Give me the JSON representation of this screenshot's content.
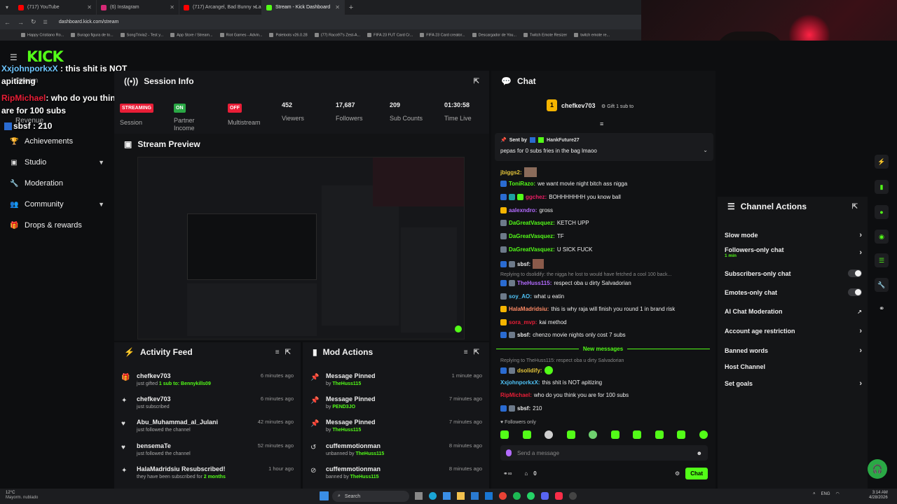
{
  "browser": {
    "tabs": [
      {
        "label": "(717) YouTube",
        "color": "#ff0000"
      },
      {
        "label": "(6) Instagram",
        "color": "#d62976"
      },
      {
        "label": "(717) Arcangel, Bad Bunny - La",
        "color": "#ff0000"
      },
      {
        "label": "Stream - Kick Dashboard",
        "color": "#53fc18"
      }
    ],
    "url": "dashboard.kick.com/stream",
    "bookmarks": [
      "Happy Cristiano Ro...",
      "Burago figura de to...",
      "SongTrivia2 - Test y...",
      "App Store / Stream...",
      "Riot Games - Advin...",
      "Paletools v26.0.28",
      "(77) Raco97's Zest-A...",
      "FIFA 23 FUT Card Cr...",
      "FIFA 23 Card creator...",
      "Descargador de You...",
      "Twitch Emote Resizer",
      "twitch emote re..."
    ]
  },
  "logo": "KICK",
  "overlay": {
    "line1_user": "XxjohnporkxX",
    "line1_text": " : this shit is NOT",
    "line2": "apitizing",
    "line3_user": "RipMichael",
    "line3_text": ": who do you think you",
    "line4": "are for 100 subs",
    "line5_user": "sbsf",
    "line5_text": ": 210"
  },
  "sidebar": {
    "stream_label": "Stream",
    "revenue_label": "Revenue",
    "items": [
      {
        "label": "Achievements",
        "icon": "trophy-icon"
      },
      {
        "label": "Studio",
        "icon": "video-icon"
      },
      {
        "label": "Moderation",
        "icon": "wrench-icon"
      },
      {
        "label": "Community",
        "icon": "people-icon"
      },
      {
        "label": "Drops & rewards",
        "icon": "gift-icon"
      }
    ]
  },
  "session": {
    "title": "Session Info",
    "stats": [
      {
        "value": "STREAMING",
        "label": "Session",
        "badge": true,
        "color": "#e91e37"
      },
      {
        "value": "ON",
        "label": "Partner Income",
        "badge": true,
        "color": "#2aa845"
      },
      {
        "value": "OFF",
        "label": "Multistream",
        "badge": true,
        "color": "#e91e37"
      },
      {
        "value": "452",
        "label": "Viewers"
      },
      {
        "value": "17,687",
        "label": "Followers"
      },
      {
        "value": "209",
        "label": "Sub Counts"
      },
      {
        "value": "01:30:58",
        "label": "Time Live"
      }
    ]
  },
  "preview": {
    "title": "Stream Preview"
  },
  "activity": {
    "title": "Activity Feed",
    "items": [
      {
        "user": "chefkev703",
        "line": "just gifted",
        "highlight": "1 sub to: Bennykills09",
        "time": "6 minutes ago",
        "icon": "gift-icon"
      },
      {
        "user": "chefkev703",
        "line": "just subscribed",
        "highlight": "",
        "time": "6 minutes ago",
        "icon": "star-icon"
      },
      {
        "user": "Abu_Muhammad_al_Julani",
        "line": "just followed the channel",
        "highlight": "",
        "time": "42 minutes ago",
        "icon": "heart-icon"
      },
      {
        "user": "bensemaTe",
        "line": "just followed the channel",
        "highlight": "",
        "time": "52 minutes ago",
        "icon": "heart-icon"
      },
      {
        "user": "HalaMadridsiu Resubscribed!",
        "line": "they have been subscribed for",
        "highlight": "2 months",
        "time": "1 hour ago",
        "icon": "star-icon"
      }
    ]
  },
  "mod": {
    "title": "Mod Actions",
    "items": [
      {
        "action": "Message Pinned",
        "by": "TheHuss115",
        "time": "1 minute ago",
        "prefix": "by",
        "icon": "pin-icon"
      },
      {
        "action": "Message Pinned",
        "by": "PEND3JO",
        "time": "7 minutes ago",
        "prefix": "by",
        "icon": "pin-icon"
      },
      {
        "action": "Message Pinned",
        "by": "TheHuss115",
        "time": "7 minutes ago",
        "prefix": "by",
        "icon": "pin-icon"
      },
      {
        "action": "cuffemmotionman",
        "by": "TheHuss115",
        "time": "8 minutes ago",
        "prefix": "unbanned by",
        "icon": "undo-icon"
      },
      {
        "action": "cuffemmotionman",
        "by": "TheHuss115",
        "time": "8 minutes ago",
        "prefix": "banned by",
        "icon": "ban-icon"
      }
    ]
  },
  "chat": {
    "title": "Chat",
    "gifter": "chefkev703",
    "gift_count": "1",
    "gift_text": "Gift 1 sub to",
    "pinned_by_label": "Sent by",
    "pinned_user": "HankFuture27",
    "pinned_text": "pepas for 0 subs fries in the bag lmaoo",
    "messages": [
      {
        "user": "jbiggs2:",
        "text": "",
        "color": "#e5c53a"
      },
      {
        "user": "ToniRazo:",
        "text": "we want movie night bitch ass nigga",
        "color": "#53fc18"
      },
      {
        "user": "ggchez:",
        "text": "BOHHHHHHH you know ball",
        "color": "#e91e63"
      },
      {
        "user": "aalexndro:",
        "text": "gross",
        "color": "#b36bff"
      },
      {
        "user": "DaGreatVasquez:",
        "text": "KETCH UPP",
        "color": "#53fc18"
      },
      {
        "user": "DaGreatVasquez:",
        "text": "TF",
        "color": "#53fc18"
      },
      {
        "user": "DaGreatVasquez:",
        "text": "U SICK FUCK",
        "color": "#53fc18"
      },
      {
        "user": "sbsf:",
        "text": "",
        "color": "#eeeeee"
      }
    ],
    "reply1": "Replying to dsolidify: the nigga he lost to would have fetched a cool 100 back...",
    "messages2": [
      {
        "user": "TheHuss115:",
        "text": "respect oba u dirty Salvadorian",
        "color": "#b36bff"
      },
      {
        "user": "soy_AO:",
        "text": "what u eatin",
        "color": "#4fc3f7"
      },
      {
        "user": "HalaMadridsiu:",
        "text": "this is why raja will finish you round 1 in brand risk",
        "color": "#ff8a65"
      },
      {
        "user": "sora_mvp:",
        "text": "kai method",
        "color": "#e91e37"
      },
      {
        "user": "sbsf:",
        "text": "chenzo movie nights only cost 7 subs",
        "color": "#eeeeee"
      }
    ],
    "new_messages": "New messages",
    "reply2": "Replying to TheHuss115: respect oba u dirty Salvadorian",
    "messages3": [
      {
        "user": "dsolidify:",
        "text": "",
        "color": "#e5c53a"
      },
      {
        "user": "XxjohnporkxX:",
        "text": "this shit is NOT apitizing",
        "color": "#4fc3f7"
      },
      {
        "user": "RipMichael:",
        "text": "who do you think you are for 100 subs",
        "color": "#e91e37"
      },
      {
        "user": "sbsf:",
        "text": "210",
        "color": "#eeeeee"
      }
    ],
    "followers_only": "Followers only",
    "input_placeholder": "Send a message",
    "count_a": "0",
    "send_label": "Chat"
  },
  "channel_actions": {
    "title": "Channel Actions",
    "rows": [
      {
        "label": "Slow mode",
        "sub": "",
        "control": "chevron"
      },
      {
        "label": "Followers-only chat",
        "sub": "1 min",
        "control": "chevron"
      },
      {
        "label": "Subscribers-only chat",
        "sub": "",
        "control": "toggle"
      },
      {
        "label": "Emotes-only chat",
        "sub": "",
        "control": "toggle"
      },
      {
        "label": "AI Chat Moderation",
        "sub": "",
        "control": "external"
      },
      {
        "label": "Account age restriction",
        "sub": "",
        "control": "chevron"
      },
      {
        "label": "Banned words",
        "sub": "",
        "control": "chevron"
      },
      {
        "label": "Host Channel",
        "sub": "",
        "control": "none"
      },
      {
        "label": "Set goals",
        "sub": "",
        "control": "chevron"
      }
    ]
  },
  "taskbar": {
    "weather_temp": "12°C",
    "weather_desc": "Mayorm. nublado",
    "search": "Search",
    "lang": "ENG",
    "time": "3:14 AM",
    "date": "4/28/2026"
  },
  "colors": {
    "accent": "#53fc18"
  }
}
